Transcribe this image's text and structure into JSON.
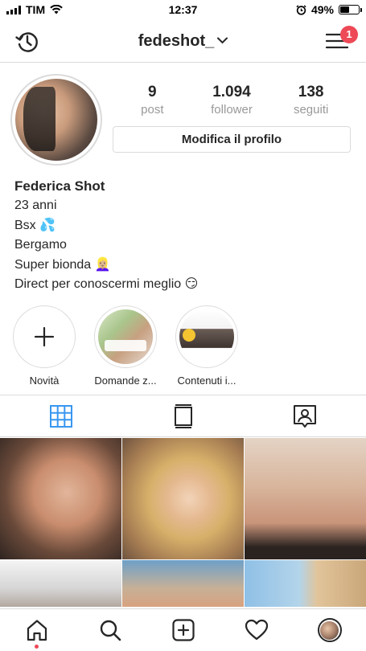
{
  "status_bar": {
    "carrier": "TIM",
    "time": "12:37",
    "battery_percent": "49%",
    "battery_level": 0.49
  },
  "header": {
    "username": "fedeshot_",
    "notification_count": "1"
  },
  "profile": {
    "stats": [
      {
        "value": "9",
        "label": "post"
      },
      {
        "value": "1.094",
        "label": "follower"
      },
      {
        "value": "138",
        "label": "seguiti"
      }
    ],
    "edit_button_label": "Modifica il profilo"
  },
  "bio": {
    "name": "Federica Shot",
    "lines": [
      "23 anni",
      "Bsx 💦",
      "Bergamo",
      "Super bionda 👱🏼‍♀️",
      "Direct per conoscermi meglio 😏"
    ]
  },
  "highlights": [
    {
      "label": "Novità"
    },
    {
      "label": "Domande z..."
    },
    {
      "label": "Contenuti i..."
    }
  ],
  "tabs": [
    {
      "icon": "grid-icon",
      "active": true
    },
    {
      "icon": "feed-list-icon",
      "active": false
    },
    {
      "icon": "tagged-user-icon",
      "active": false
    }
  ],
  "colors": {
    "accent_blue": "#3897f0",
    "badge_red": "#ed4956",
    "border": "#dbdbdb",
    "text": "#262626",
    "muted": "#999999"
  }
}
